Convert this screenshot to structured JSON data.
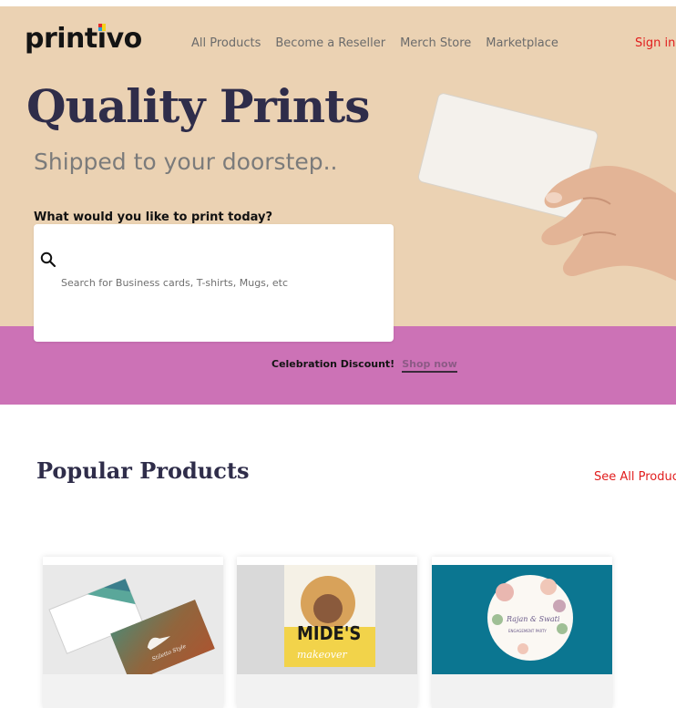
{
  "header": {
    "logo_text_before": "print",
    "logo_text_i": "i",
    "logo_text_after": "vo",
    "nav": [
      "All Products",
      "Become a Reseller",
      "Merch Store",
      "Marketplace"
    ],
    "sign_in": "Sign in"
  },
  "hero": {
    "title": "Quality Prints",
    "subtitle": "Shipped to your doorstep..",
    "question": "What would you like to print today?",
    "search": {
      "value": "",
      "placeholder": "Search for Business cards, T-shirts, Mugs, etc"
    }
  },
  "promo": {
    "label": "Celebration Discount!",
    "link": "Shop now"
  },
  "popular": {
    "title": "Popular Products",
    "see_all": "See All Products",
    "cards": [
      {
        "image": "business-cards-image",
        "brand_text": "Stiletto Style"
      },
      {
        "image": "flyer-image",
        "headline": "MIDE'S",
        "script": "makeover"
      },
      {
        "image": "sticker-image",
        "line1": "Rajan & Swati",
        "line2": "ENGAGEMENT PARTY"
      }
    ]
  },
  "colors": {
    "hero_bg": "#ebd2b3",
    "promo_bg": "#cc72b6",
    "title": "#2f2d4a",
    "accent_red": "#e11d1d"
  }
}
